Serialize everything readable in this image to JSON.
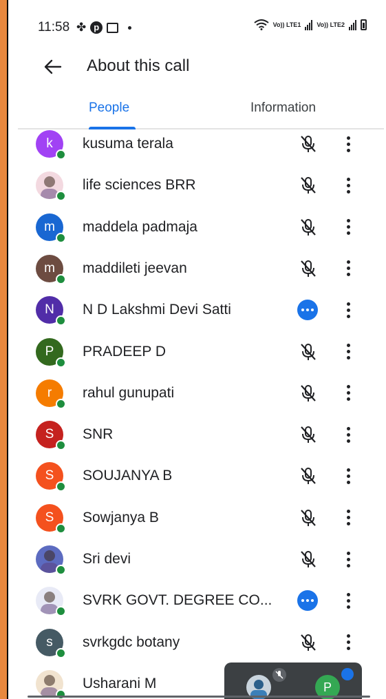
{
  "status_bar": {
    "time": "11:58",
    "lte1_label": "Vo)) LTE1",
    "lte2_label": "Vo)) LTE2"
  },
  "header": {
    "title": "About this call",
    "back_icon": "arrow-back-icon"
  },
  "tabs": [
    {
      "label": "People",
      "active": true
    },
    {
      "label": "Information",
      "active": false
    }
  ],
  "colors": {
    "accent": "#1a73e8",
    "online": "#1e8e3e"
  },
  "participants": [
    {
      "name": "kusuma terala",
      "initial": "k",
      "color": "#a142f4",
      "status": "muted"
    },
    {
      "name": "life sciences BRR",
      "initial": "",
      "color": "#f3d9e0",
      "status": "muted",
      "photo": true
    },
    {
      "name": "maddela padmaja",
      "initial": "m",
      "color": "#1967d2",
      "status": "muted"
    },
    {
      "name": "maddileti jeevan",
      "initial": "m",
      "color": "#6d4c41",
      "status": "muted"
    },
    {
      "name": "N D Lakshmi Devi Satti",
      "initial": "N",
      "color": "#512da8",
      "status": "more"
    },
    {
      "name": "PRADEEP D",
      "initial": "P",
      "color": "#33691e",
      "status": "muted"
    },
    {
      "name": "rahul gunupati",
      "initial": "r",
      "color": "#f57c00",
      "status": "muted"
    },
    {
      "name": "SNR",
      "initial": "S",
      "color": "#c5221f",
      "status": "muted"
    },
    {
      "name": "SOUJANYA B",
      "initial": "S",
      "color": "#f4511e",
      "status": "muted"
    },
    {
      "name": "Sowjanya B",
      "initial": "S",
      "color": "#f4511e",
      "status": "muted"
    },
    {
      "name": "Sri devi",
      "initial": "",
      "color": "#5c6bc0",
      "status": "muted",
      "photo": true
    },
    {
      "name": "SVRK GOVT. DEGREE CO...",
      "initial": "",
      "color": "#e8eaf6",
      "status": "more",
      "photo": true
    },
    {
      "name": "svrkgdc botany",
      "initial": "s",
      "color": "#455a64",
      "status": "muted"
    },
    {
      "name": "Usharani M",
      "initial": "",
      "color": "#f1e3cf",
      "status": "none",
      "photo": true
    }
  ],
  "pip": {
    "second_initial": "P"
  }
}
